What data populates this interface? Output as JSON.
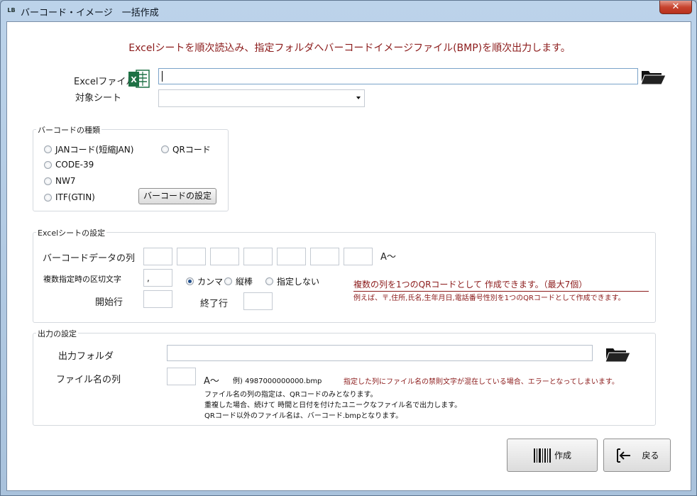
{
  "window": {
    "title": "バーコード・イメージ　一括作成",
    "icon_label": "LB",
    "close_label": "✕"
  },
  "headline": "Excelシートを順次読込み、指定フォルダへバーコードイメージファイル(BMP)を順次出力します。",
  "excel": {
    "file_label": "Excelファイル",
    "file_value": "",
    "sheet_label": "対象シート",
    "sheet_value": ""
  },
  "barcode_type": {
    "title": "バーコードの種類",
    "options": [
      "JANコード(短縮JAN)",
      "QRコード",
      "CODE-39",
      "NW7",
      "ITF(GTIN)"
    ],
    "settings_button": "バーコードの設定"
  },
  "sheet_settings": {
    "title": "Excelシートの設定",
    "data_col_label": "バーコードデータの列",
    "data_col_suffix": "A～",
    "data_cols": [
      "",
      "",
      "",
      "",
      "",
      "",
      ""
    ],
    "delimiter_label": "複数指定時の区切文字",
    "delimiter_value": ",",
    "delimiter_options": [
      "カンマ",
      "縦棒",
      "指定しない"
    ],
    "delimiter_selected": "カンマ",
    "start_row_label": "開始行",
    "end_row_label": "終了行",
    "start_row_value": "",
    "end_row_value": "",
    "note_main": "複数の列を1つのQRコードとして 作成できます。（最大7個）",
    "note_example": "例えば、〒,住所,氏名,生年月日,電話番号性別を1つのQRコードとして作成できます。"
  },
  "output_settings": {
    "title": "出力の設定",
    "folder_label": "出力フォルダ",
    "folder_value": "",
    "filename_col_label": "ファイル名の列",
    "filename_col_value": "",
    "filename_suffix": "A～",
    "example": "例)  4987000000000.bmp",
    "warning": "指定した列にファイル名の禁則文字が混在している場合、エラーとなってしまいます。",
    "notes": [
      "ファイル名の列の指定は、QRコードのみとなります。",
      "重複した場合、続けて 時間と日付を付けたユニークなファイル名で出力します。",
      "QRコード以外のファイル名は、バーコード.bmpとなります。"
    ]
  },
  "buttons": {
    "create": "作成",
    "back": "戻る"
  },
  "icons": {
    "excel": "excel-icon",
    "folder": "folder-open-icon",
    "barcode": "barcode-icon",
    "back": "exit-arrow-icon"
  },
  "colors": {
    "note_red": "#8b1a1a",
    "excel_green": "#1e7145",
    "checked_radio": "#1f4e8c"
  }
}
